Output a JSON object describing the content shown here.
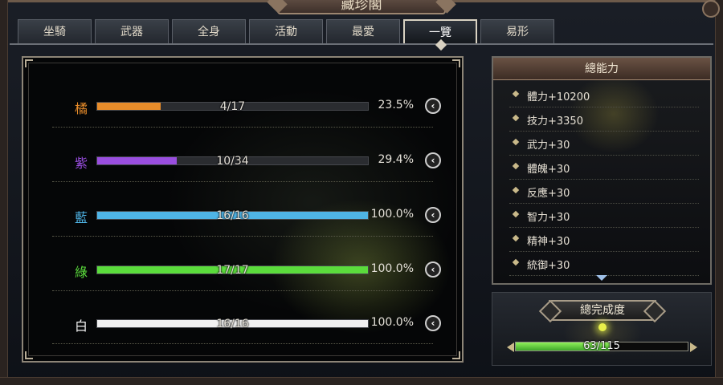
{
  "window": {
    "title": "藏珍閣"
  },
  "tabs": [
    {
      "label": "坐騎",
      "active": false
    },
    {
      "label": "武器",
      "active": false
    },
    {
      "label": "全身",
      "active": false
    },
    {
      "label": "活動",
      "active": false
    },
    {
      "label": "最愛",
      "active": false
    },
    {
      "label": "一覽",
      "active": true
    },
    {
      "label": "易形",
      "active": false
    }
  ],
  "collection": [
    {
      "grade": "橘",
      "color": "#e88c2a",
      "collected": 4,
      "total": 17,
      "count_text": "4/17",
      "percent_text": "23.5%",
      "progress": 0.235
    },
    {
      "grade": "紫",
      "color": "#9a4ee0",
      "collected": 10,
      "total": 34,
      "count_text": "10/34",
      "percent_text": "29.4%",
      "progress": 0.294
    },
    {
      "grade": "藍",
      "color": "#4fb4e6",
      "collected": 16,
      "total": 16,
      "count_text": "16/16",
      "percent_text": "100.0%",
      "progress": 1.0
    },
    {
      "grade": "綠",
      "color": "#5bdc3c",
      "collected": 17,
      "total": 17,
      "count_text": "17/17",
      "percent_text": "100.0%",
      "progress": 1.0
    },
    {
      "grade": "白",
      "color": "#f0f0f0",
      "collected": 16,
      "total": 16,
      "count_text": "16/16",
      "percent_text": "100.0%",
      "progress": 1.0
    }
  ],
  "expand_icon": "chevron-left-icon",
  "stats": {
    "header": "總能力",
    "items": [
      "體力+10200",
      "技力+3350",
      "武力+30",
      "體魄+30",
      "反應+30",
      "智力+30",
      "精神+30",
      "統御+30"
    ]
  },
  "completion": {
    "title": "總完成度",
    "collected": 63,
    "total": 115,
    "text": "63/115",
    "progress": 0.548
  }
}
